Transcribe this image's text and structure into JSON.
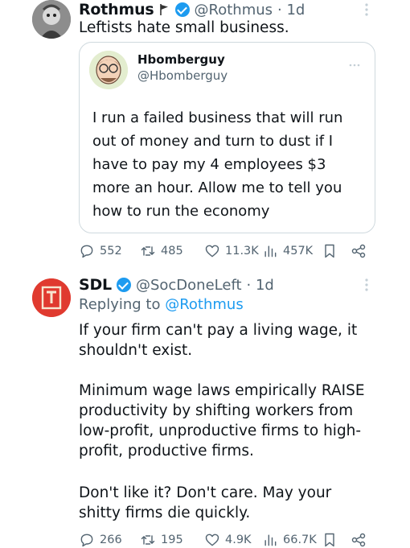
{
  "tweet1": {
    "name": "Rothmus",
    "handle": "@Rothmus",
    "time": "· 1d",
    "text": "Leftists hate small business.",
    "flag_icon": "flag-icon",
    "verified_icon": "verified-badge-icon",
    "quote": {
      "name": "Hbomberguy",
      "handle": "@Hbomberguy",
      "text": "I run a failed business that will run out of money and turn to dust if I have to pay my 4 employees $3 more an hour. Allow me to tell you how to run the economy"
    },
    "actions": {
      "replies": "552",
      "retweets": "485",
      "likes": "11.3K",
      "views": "457K"
    }
  },
  "tweet2": {
    "name": "SDL",
    "handle": "@SocDoneLeft",
    "time": "· 1d",
    "replying_prefix": "Replying to",
    "replying_to": "@Rothmus",
    "para1": "If your firm can't pay a living wage, it shouldn't exist.",
    "para2": "Minimum wage laws empirically RAISE productivity by shifting workers from low-profit, unproductive firms to high-profit, productive firms.",
    "para3": "Don't like it? Don't care. May your shitty firms die quickly.",
    "actions": {
      "replies": "266",
      "retweets": "195",
      "likes": "4.9K",
      "views": "66.7K"
    }
  },
  "colors": {
    "accent": "#1d9bf0",
    "muted": "#536471",
    "border": "#cfd9de",
    "sdl_red": "#e03a2f"
  }
}
